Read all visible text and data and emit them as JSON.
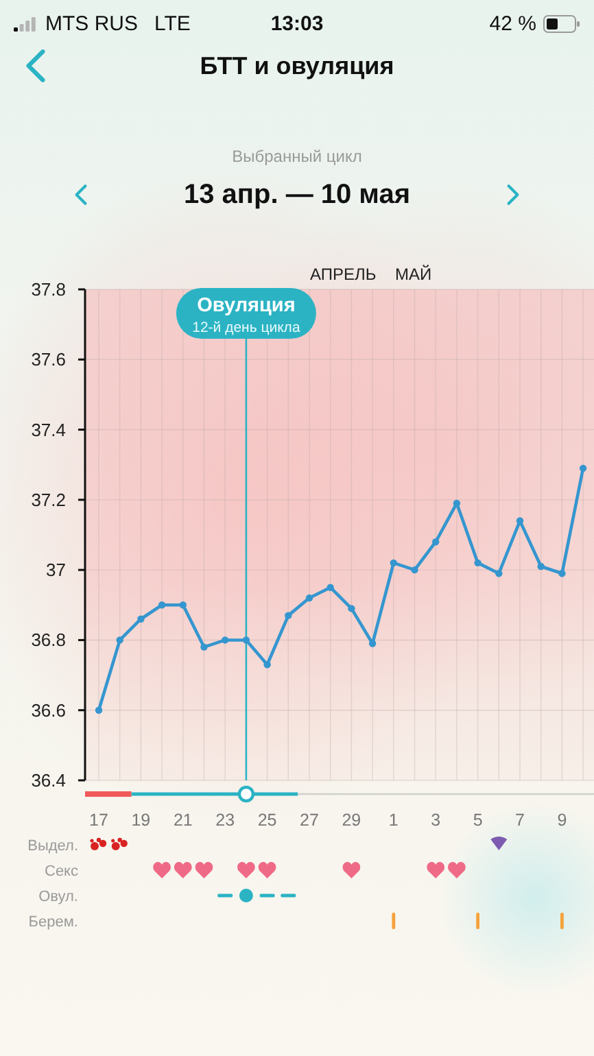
{
  "status_bar": {
    "carrier": "MTS RUS",
    "network": "LTE",
    "time": "13:03",
    "battery": "42 %"
  },
  "header": {
    "title": "БТТ и овуляция"
  },
  "cycle": {
    "caption": "Выбранный цикл",
    "range": "13 апр. — 10 мая"
  },
  "chart": {
    "months": [
      "АПРЕЛЬ",
      "МАЙ"
    ],
    "chart_data": {
      "type": "line",
      "grid": true,
      "categories": [
        "17",
        null,
        "19",
        null,
        "21",
        null,
        "23",
        null,
        "25",
        null,
        "27",
        null,
        "29",
        null,
        "1",
        null,
        "3",
        null,
        "5",
        null,
        "7",
        null,
        "9",
        null
      ],
      "series": [
        {
          "color": "#3596cf",
          "marker": "circle",
          "values": [
            36.6,
            36.8,
            36.86,
            36.9,
            36.9,
            36.78,
            36.8,
            36.8,
            36.73,
            36.87,
            36.92,
            36.95,
            36.89,
            36.79,
            37.02,
            37.0,
            37.08,
            37.19,
            37.02,
            36.99,
            37.14,
            37.01,
            36.99,
            37.29
          ]
        }
      ],
      "ylim": [
        36.4,
        37.8
      ],
      "yticks": [
        {
          "value": 36.4,
          "label": "36.4"
        },
        {
          "value": 36.6,
          "label": "36.6"
        },
        {
          "value": 36.8,
          "label": "36.8"
        },
        {
          "value": 37,
          "label": "37"
        },
        {
          "value": 37.2,
          "label": "37.2"
        },
        {
          "value": 37.4,
          "label": "37.4"
        },
        {
          "value": 37.6,
          "label": "37.6"
        },
        {
          "value": 37.8,
          "label": "37.8"
        }
      ],
      "annotations": [
        {
          "text": "Овуляция"
        },
        {
          "text": "12-й день цикла"
        }
      ]
    },
    "rows": [
      {
        "label": "Выдел.",
        "kind": "discharge",
        "marks": [
          true,
          true,
          false,
          false,
          false,
          false,
          false,
          false,
          false,
          false,
          false,
          false,
          false,
          false,
          false,
          false,
          false,
          false,
          false,
          false,
          false,
          false,
          false,
          false
        ],
        "light_marks": [
          false,
          false,
          false,
          false,
          false,
          false,
          false,
          false,
          false,
          false,
          false,
          false,
          false,
          false,
          false,
          false,
          false,
          false,
          false,
          true,
          false,
          false,
          false,
          false
        ]
      },
      {
        "label": "Секс",
        "kind": "sex",
        "marks": [
          false,
          false,
          false,
          true,
          true,
          true,
          false,
          true,
          true,
          false,
          false,
          false,
          true,
          false,
          false,
          false,
          true,
          true,
          false,
          false,
          false,
          false,
          false,
          false
        ]
      },
      {
        "label": "Овул.",
        "kind": "ovulation",
        "marks": [
          false,
          false,
          false,
          false,
          false,
          false,
          true,
          true,
          true,
          true,
          false,
          false,
          false,
          false,
          false,
          false,
          false,
          false,
          false,
          false,
          false,
          false,
          false,
          false
        ],
        "peak_marks": [
          false,
          false,
          false,
          false,
          false,
          false,
          false,
          true,
          false,
          false,
          false,
          false,
          false,
          false,
          false,
          false,
          false,
          false,
          false,
          false,
          false,
          false,
          false,
          false
        ]
      },
      {
        "label": "Берем.",
        "kind": "pregnancy",
        "marks": [
          false,
          false,
          false,
          false,
          false,
          false,
          false,
          false,
          false,
          false,
          false,
          false,
          false,
          false,
          true,
          false,
          false,
          false,
          true,
          false,
          false,
          false,
          true,
          false
        ]
      }
    ]
  }
}
